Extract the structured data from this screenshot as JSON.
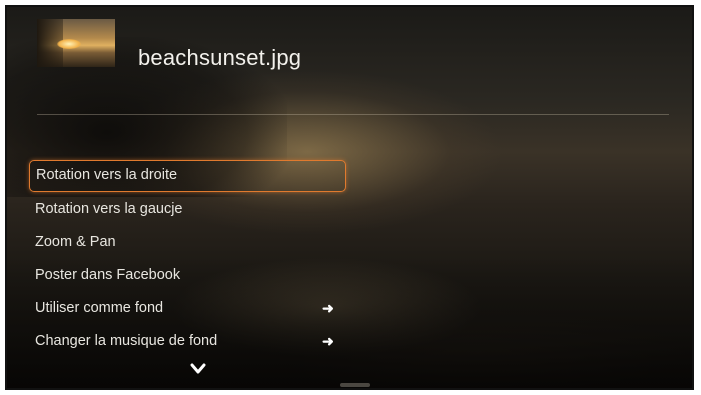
{
  "header": {
    "filename": "beachsunset.jpg",
    "thumbnail_icon": "photo-thumbnail"
  },
  "menu": {
    "items": [
      {
        "label": "Rotation vers la droite",
        "selected": true,
        "has_submenu": false
      },
      {
        "label": "Rotation vers la gaucje",
        "selected": false,
        "has_submenu": false
      },
      {
        "label": "Zoom & Pan",
        "selected": false,
        "has_submenu": false
      },
      {
        "label": "Poster dans Facebook",
        "selected": false,
        "has_submenu": false
      },
      {
        "label": "Utiliser comme fond",
        "selected": false,
        "has_submenu": true
      },
      {
        "label": "Changer la musique de fond",
        "selected": false,
        "has_submenu": true
      }
    ],
    "submenu_arrow": "➜",
    "more_indicator_icon": "chevron-down-icon"
  },
  "colors": {
    "selection_border": "#e07a2e",
    "text": "#e8e6e0",
    "title": "#f3f1ec"
  }
}
